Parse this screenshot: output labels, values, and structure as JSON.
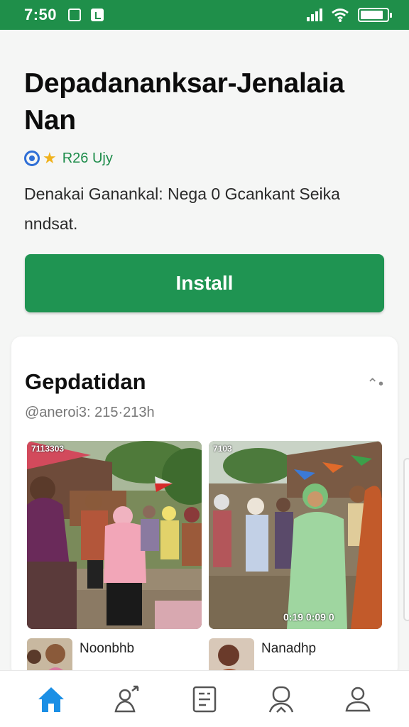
{
  "status_bar": {
    "time": "7:50",
    "battery_level": 0.85
  },
  "app": {
    "title": "Depadananksar-Jenalaia Nan",
    "rating_text": "R26 Ujy",
    "description": "Denakai Ganankal: Nega 0 Gcankant Seika nndsat.",
    "install_label": "Install"
  },
  "update_card": {
    "title": "Gepdatidan",
    "meta": "@aneroi3: 215·213h",
    "photo_1_tag": "7113303",
    "photo_2_tag": "7103",
    "photo_2_caption": "0:19 0:09 0",
    "items": [
      {
        "label": "Noonbhb"
      },
      {
        "label": "Nanadhp"
      }
    ]
  },
  "colors": {
    "accent": "#1f9452",
    "status_bar": "#1f8f4a",
    "nav_active": "#1b8fe5",
    "rating": "#1d8c4a"
  },
  "bottom_nav": [
    {
      "icon": "home-icon",
      "active": true
    },
    {
      "icon": "people-icon",
      "active": false
    },
    {
      "icon": "list-icon",
      "active": false
    },
    {
      "icon": "profile-group-icon",
      "active": false
    },
    {
      "icon": "profile-icon",
      "active": false
    }
  ]
}
